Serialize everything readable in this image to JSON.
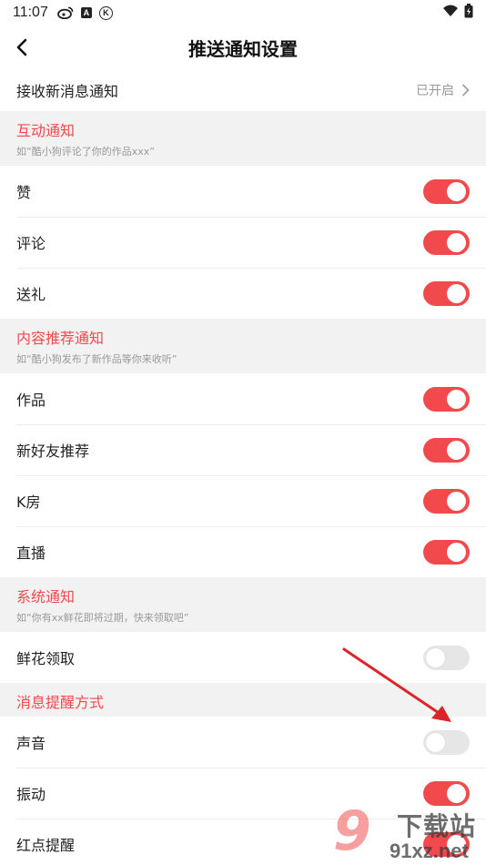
{
  "status_bar": {
    "time": "11:07",
    "icons": [
      "weibo-icon",
      "a-badge-icon",
      "k-circle-icon"
    ],
    "a_badge": "A",
    "k_badge": "K",
    "right_icons": [
      "wifi-icon",
      "battery-charging-icon"
    ]
  },
  "nav": {
    "title": "推送通知设置",
    "back_icon": "chevron-left-icon"
  },
  "receive": {
    "label": "接收新消息通知",
    "value": "已开启"
  },
  "sections": [
    {
      "title": "互动通知",
      "subtitle": "如“酷小狗评论了你的作品xxx”",
      "items": [
        {
          "label": "赞",
          "on": true
        },
        {
          "label": "评论",
          "on": true
        },
        {
          "label": "送礼",
          "on": true
        }
      ]
    },
    {
      "title": "内容推荐通知",
      "subtitle": "如“酷小狗发布了新作品等你来收听”",
      "items": [
        {
          "label": "作品",
          "on": true
        },
        {
          "label": "新好友推荐",
          "on": true
        },
        {
          "label": "K房",
          "on": true
        },
        {
          "label": "直播",
          "on": true
        }
      ]
    },
    {
      "title": "系统通知",
      "subtitle": "如“你有xx鲜花即将过期，快来领取吧”",
      "items": [
        {
          "label": "鲜花领取",
          "on": false
        }
      ]
    },
    {
      "title": "消息提醒方式",
      "subtitle": "",
      "items": [
        {
          "label": "声音",
          "on": false
        },
        {
          "label": "振动",
          "on": true
        },
        {
          "label": "红点提醒",
          "on": true
        }
      ]
    }
  ],
  "watermark": {
    "big": "9",
    "top": "下载站",
    "bottom": "91xz.net"
  },
  "colors": {
    "accent": "#f2494d",
    "toggle_off": "#e6e6e6",
    "section_bg": "#f2f2f2",
    "arrow": "#d9262b"
  }
}
